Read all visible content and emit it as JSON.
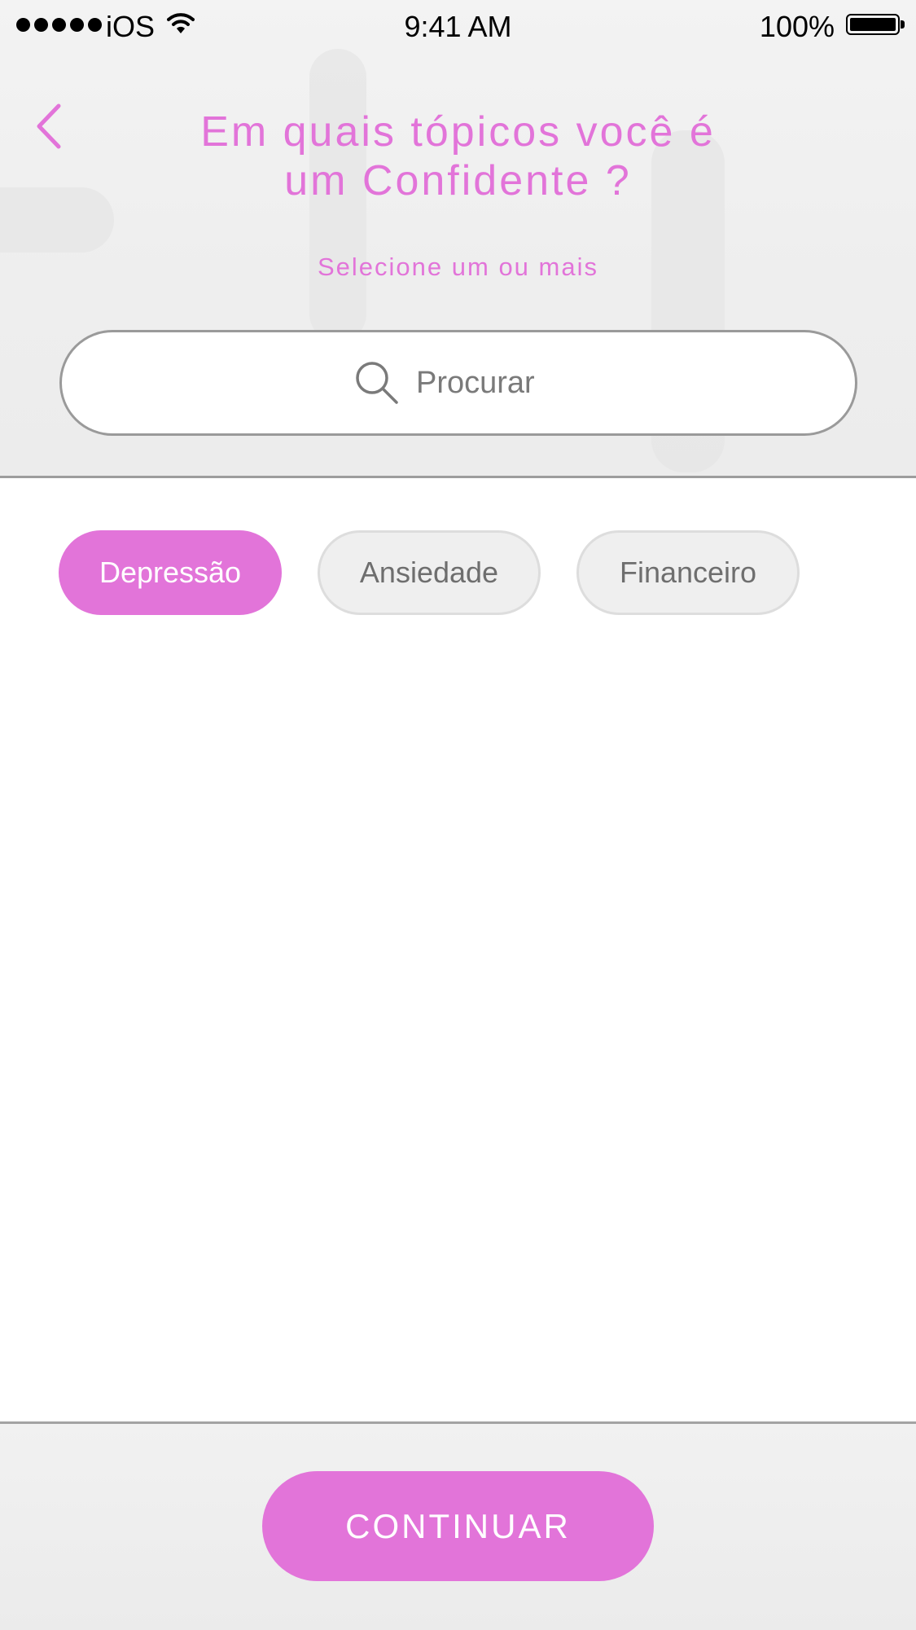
{
  "status_bar": {
    "carrier": "iOS",
    "time": "9:41 AM",
    "battery": "100%",
    "signal_icon": "signal-dots-icon",
    "wifi_icon": "wifi-icon",
    "battery_icon": "battery-icon"
  },
  "header": {
    "back_icon": "chevron-left-icon",
    "title_line1": "Em quais tópicos você é",
    "title_line2": "um Confidente ?",
    "subtitle": "Selecione um ou mais"
  },
  "search": {
    "placeholder": "Procurar",
    "value": "",
    "icon": "search-icon"
  },
  "topics": [
    {
      "label": "Depressão",
      "selected": true
    },
    {
      "label": "Ansiedade",
      "selected": false
    },
    {
      "label": "Financeiro",
      "selected": false
    }
  ],
  "footer": {
    "continue_label": "CONTINUAR"
  },
  "colors": {
    "accent": "#e274d9",
    "chip_unselected_bg": "#efefef",
    "chip_unselected_text": "#6e6e6e",
    "divider": "#9d9d9d"
  }
}
